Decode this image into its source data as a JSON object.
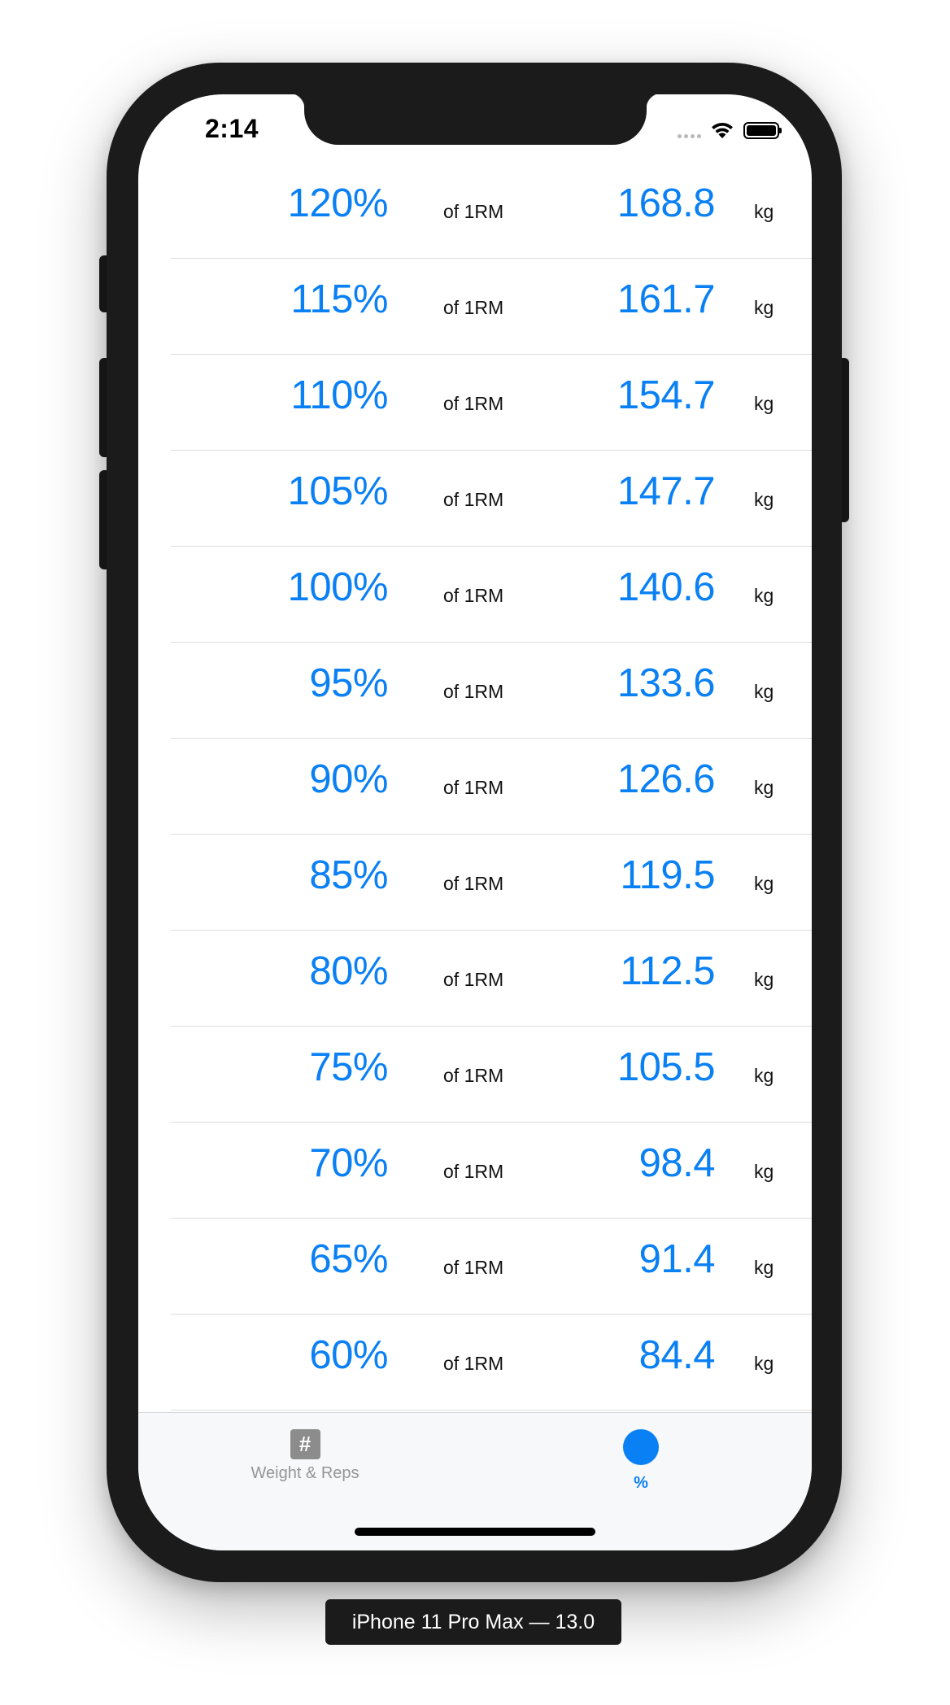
{
  "status_bar": {
    "time": "2:14"
  },
  "table": {
    "rows": [
      {
        "percent": "120%",
        "of_label": "of 1RM",
        "weight": "168.8",
        "unit": "kg"
      },
      {
        "percent": "115%",
        "of_label": "of 1RM",
        "weight": "161.7",
        "unit": "kg"
      },
      {
        "percent": "110%",
        "of_label": "of 1RM",
        "weight": "154.7",
        "unit": "kg"
      },
      {
        "percent": "105%",
        "of_label": "of 1RM",
        "weight": "147.7",
        "unit": "kg"
      },
      {
        "percent": "100%",
        "of_label": "of 1RM",
        "weight": "140.6",
        "unit": "kg"
      },
      {
        "percent": "95%",
        "of_label": "of 1RM",
        "weight": "133.6",
        "unit": "kg"
      },
      {
        "percent": "90%",
        "of_label": "of 1RM",
        "weight": "126.6",
        "unit": "kg"
      },
      {
        "percent": "85%",
        "of_label": "of 1RM",
        "weight": "119.5",
        "unit": "kg"
      },
      {
        "percent": "80%",
        "of_label": "of 1RM",
        "weight": "112.5",
        "unit": "kg"
      },
      {
        "percent": "75%",
        "of_label": "of 1RM",
        "weight": "105.5",
        "unit": "kg"
      },
      {
        "percent": "70%",
        "of_label": "of 1RM",
        "weight": "98.4",
        "unit": "kg"
      },
      {
        "percent": "65%",
        "of_label": "of 1RM",
        "weight": "91.4",
        "unit": "kg"
      },
      {
        "percent": "60%",
        "of_label": "of 1RM",
        "weight": "84.4",
        "unit": "kg"
      }
    ]
  },
  "tabbar": {
    "weight_reps": {
      "icon": "hash-icon",
      "icon_glyph": "#",
      "label": "Weight & Reps"
    },
    "percent": {
      "icon": "dot-icon",
      "label": "%"
    }
  },
  "device_caption": "iPhone 11 Pro Max — 13.0",
  "colors": {
    "accent": "#0a80f5",
    "frame": "#1b1b1c",
    "inactive_tab": "#959595"
  }
}
